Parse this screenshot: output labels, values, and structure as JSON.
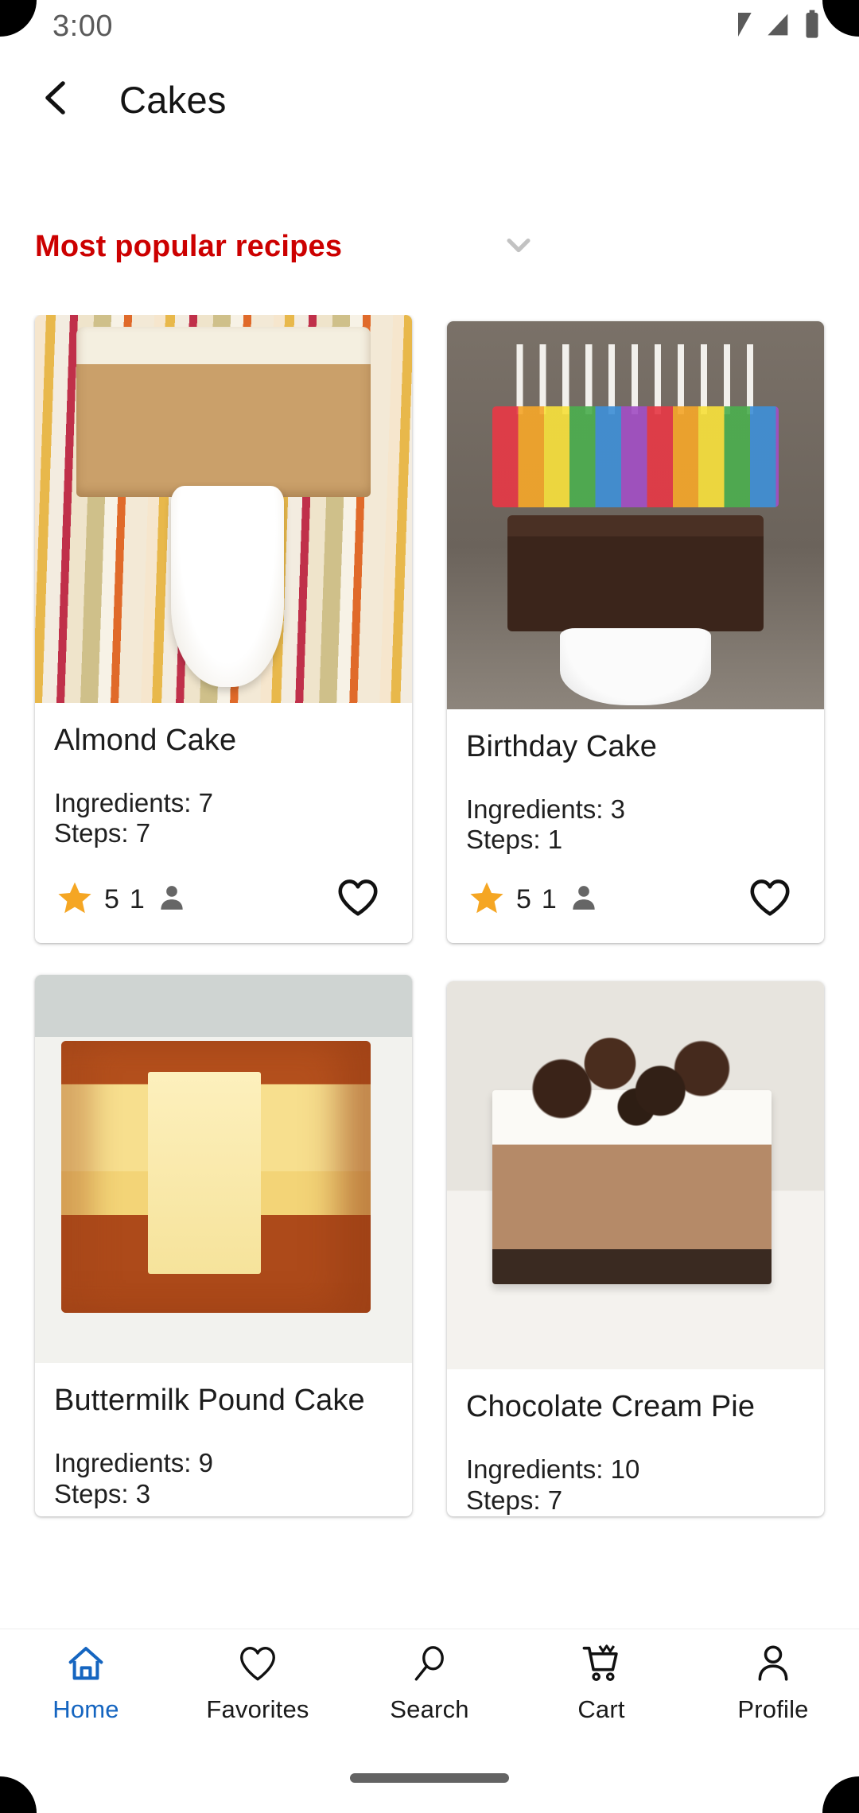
{
  "status_bar": {
    "time": "3:00",
    "icons": [
      "wifi-icon",
      "cellular-signal-icon",
      "battery-icon"
    ]
  },
  "app_bar": {
    "back_icon": "chevron-left-icon",
    "title": "Cakes"
  },
  "section": {
    "title": "Most popular recipes",
    "title_color": "#cc0000",
    "expand_icon": "chevron-down-icon"
  },
  "labels": {
    "ingredients_prefix": "Ingredients:",
    "steps_prefix": "Steps:"
  },
  "icons": {
    "star": "star-icon",
    "person": "person-icon",
    "heart_outline": "heart-outline-icon"
  },
  "colors": {
    "star": "#f5a623",
    "person": "#666666",
    "accent_red": "#cc0000",
    "active_nav": "#1565c0"
  },
  "recipes": [
    {
      "title": "Almond Cake",
      "ingredients": "Ingredients: 7",
      "steps": "Steps: 7",
      "rating": "5",
      "reviews": "1",
      "image": "almond-cake-photo",
      "favorited": false
    },
    {
      "title": "Birthday Cake",
      "ingredients": "Ingredients: 3",
      "steps": "Steps: 1",
      "rating": "5",
      "reviews": "1",
      "image": "birthday-cake-photo",
      "favorited": false
    },
    {
      "title": "Buttermilk Pound Cake",
      "ingredients": "Ingredients: 9",
      "steps": "Steps: 3",
      "rating": "",
      "reviews": "",
      "image": "buttermilk-pound-cake-photo",
      "favorited": false
    },
    {
      "title": "Chocolate Cream Pie",
      "ingredients": "Ingredients: 10",
      "steps": "Steps: 7",
      "rating": "",
      "reviews": "",
      "image": "chocolate-cream-pie-photo",
      "favorited": false
    }
  ],
  "bottom_nav": {
    "active": "Home",
    "items": [
      {
        "label": "Home",
        "icon": "home-icon"
      },
      {
        "label": "Favorites",
        "icon": "heart-outline-icon"
      },
      {
        "label": "Search",
        "icon": "magnifier-icon"
      },
      {
        "label": "Cart",
        "icon": "shopping-cart-icon"
      },
      {
        "label": "Profile",
        "icon": "person-outline-icon"
      }
    ]
  }
}
